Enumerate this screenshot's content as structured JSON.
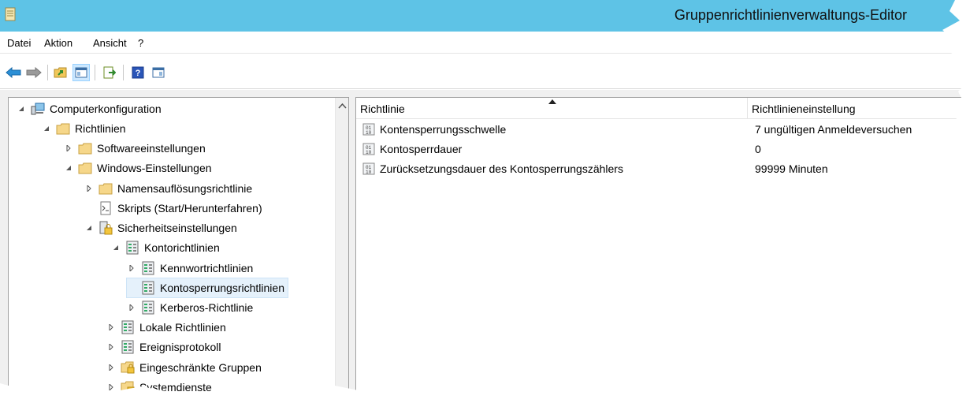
{
  "window": {
    "title": "Gruppenrichtlinienverwaltungs-Editor",
    "titlebar_color": "#5ec3e6"
  },
  "menu": {
    "items": [
      "Datei",
      "Aktion",
      "Ansicht",
      "?"
    ]
  },
  "toolbar": {
    "buttons": [
      "back-icon",
      "forward-icon",
      "up-folder-icon",
      "show-hide-tree-icon",
      "export-list-icon",
      "help-icon",
      "show-hide-action-pane-icon"
    ]
  },
  "tree": {
    "nodes": [
      {
        "label": "Computerkonfiguration",
        "icon": "computer-icon",
        "expander": "expanded"
      },
      {
        "label": "Richtlinien",
        "icon": "folder-icon",
        "expander": "expanded"
      },
      {
        "label": "Softwareeinstellungen",
        "icon": "folder-icon",
        "expander": "collapsed"
      },
      {
        "label": "Windows-Einstellungen",
        "icon": "folder-icon",
        "expander": "expanded"
      },
      {
        "label": "Namensauflösungsrichtlinie",
        "icon": "folder-icon",
        "expander": "collapsed"
      },
      {
        "label": "Skripts (Start/Herunterfahren)",
        "icon": "script-icon",
        "expander": "none"
      },
      {
        "label": "Sicherheitseinstellungen",
        "icon": "security-icon",
        "expander": "expanded"
      },
      {
        "label": "Kontorichtlinien",
        "icon": "policy-icon",
        "expander": "expanded"
      },
      {
        "label": "Kennwortrichtlinien",
        "icon": "policy-icon",
        "expander": "collapsed"
      },
      {
        "label": "Kontosperrungsrichtlinien",
        "icon": "policy-icon",
        "expander": "none",
        "selected": true
      },
      {
        "label": "Kerberos-Richtlinie",
        "icon": "policy-icon",
        "expander": "collapsed"
      },
      {
        "label": "Lokale Richtlinien",
        "icon": "policy-icon",
        "expander": "collapsed"
      },
      {
        "label": "Ereignisprotokoll",
        "icon": "policy-icon",
        "expander": "collapsed"
      },
      {
        "label": "Eingeschränkte Gruppen",
        "icon": "security-folder-icon",
        "expander": "collapsed"
      },
      {
        "label": "Systemdienste",
        "icon": "security-folder-icon",
        "expander": "collapsed"
      }
    ]
  },
  "list": {
    "columns": [
      "Richtlinie",
      "Richtlinieneinstellung"
    ],
    "rows": [
      {
        "name": "Kontensperrungsschwelle",
        "value": "7 ungültigen Anmeldeversuchen"
      },
      {
        "name": "Kontosperrdauer",
        "value": "0"
      },
      {
        "name": "Zurücksetzungsdauer des Kontosperrungszählers",
        "value": "99999 Minuten"
      }
    ]
  }
}
